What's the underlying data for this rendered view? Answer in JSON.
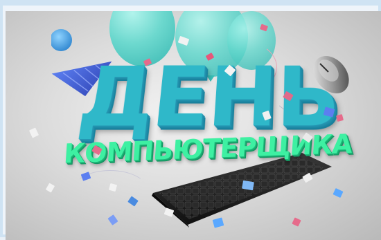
{
  "poster": {
    "title": "ДЕНЬ",
    "subtitle": "КОМПЬЮТЕРЩИКА"
  },
  "colors": {
    "background": "#d8d8d8",
    "title": "#2fb8c9",
    "subtitle": "#3ef0a2",
    "balloon": "#63d8cd",
    "hat": "#3f5fd6",
    "pompom": "#4aa9e6"
  },
  "objects": [
    "party-hat-icon",
    "computer-mouse-icon",
    "keyboard-icon",
    "balloon-icon",
    "confetti"
  ]
}
